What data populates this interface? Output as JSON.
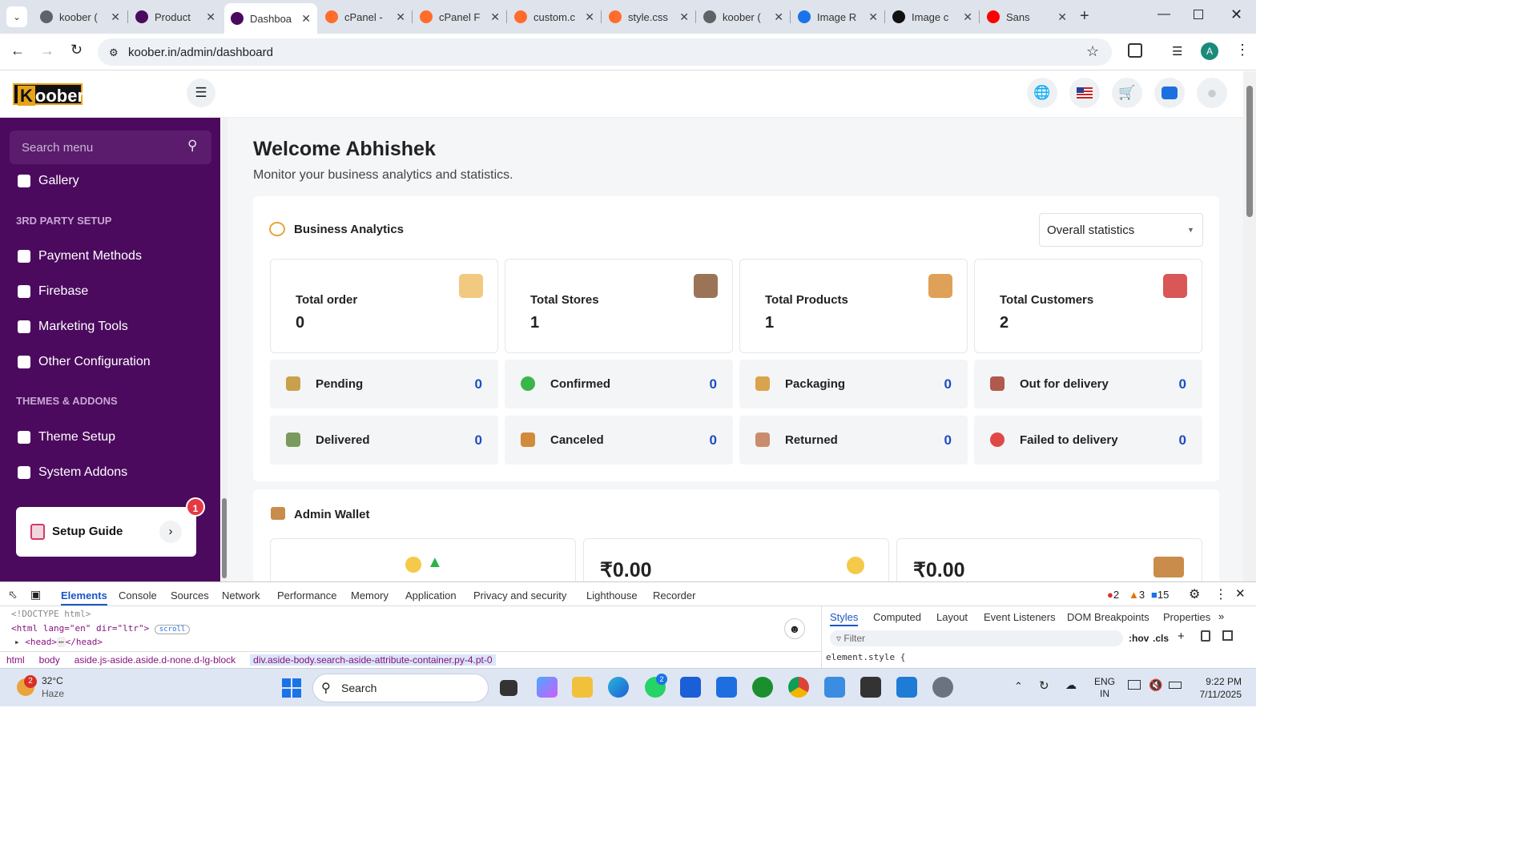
{
  "browser": {
    "tabs": [
      {
        "label": "koober (",
        "color": "#5f6368"
      },
      {
        "label": "Product",
        "color": "#4b0a5e"
      },
      {
        "label": "Dashboa",
        "color": "#4b0a5e"
      },
      {
        "label": "cPanel -",
        "color": "#ff6c2c"
      },
      {
        "label": "cPanel F",
        "color": "#ff6c2c"
      },
      {
        "label": "custom.c",
        "color": "#ff6c2c"
      },
      {
        "label": "style.css",
        "color": "#ff6c2c"
      },
      {
        "label": "koober (",
        "color": "#5f6368"
      },
      {
        "label": "Image R",
        "color": "#1a73e8"
      },
      {
        "label": "Image c",
        "color": "#111111"
      },
      {
        "label": "Sans",
        "color": "#ff0000"
      }
    ],
    "url": "koober.in/admin/dashboard",
    "profile_initial": "A"
  },
  "logo": {
    "k": "K",
    "rest": "oober"
  },
  "sidebar": {
    "search_placeholder": "Search menu",
    "gallery": "Gallery",
    "section_3rd": "3RD PARTY SETUP",
    "payment": "Payment Methods",
    "firebase": "Firebase",
    "marketing": "Marketing Tools",
    "other": "Other Configuration",
    "section_themes": "THEMES & ADDONS",
    "theme": "Theme Setup",
    "addons": "System Addons",
    "setup_guide": "Setup Guide",
    "setup_badge": "1"
  },
  "main": {
    "welcome": "Welcome Abhishek",
    "subtitle": "Monitor your business analytics and statistics.",
    "analytics_title": "Business Analytics",
    "dropdown": "Overall statistics",
    "stats": [
      {
        "label": "Total order",
        "value": "0",
        "icon": "order-icon"
      },
      {
        "label": "Total Stores",
        "value": "1",
        "icon": "store-icon"
      },
      {
        "label": "Total Products",
        "value": "1",
        "icon": "product-icon"
      },
      {
        "label": "Total Customers",
        "value": "2",
        "icon": "customer-icon"
      }
    ],
    "statuses": [
      {
        "label": "Pending",
        "value": "0",
        "color": "#c9a14b"
      },
      {
        "label": "Confirmed",
        "value": "0",
        "color": "#39b54a"
      },
      {
        "label": "Packaging",
        "value": "0",
        "color": "#d9a44b"
      },
      {
        "label": "Out for delivery",
        "value": "0",
        "color": "#b05a4b"
      },
      {
        "label": "Delivered",
        "value": "0",
        "color": "#7a9b5e"
      },
      {
        "label": "Canceled",
        "value": "0",
        "color": "#d18b3a"
      },
      {
        "label": "Returned",
        "value": "0",
        "color": "#c98c6c"
      },
      {
        "label": "Failed to delivery",
        "value": "0",
        "color": "#e04848"
      }
    ],
    "wallet_title": "Admin Wallet",
    "wallet_values": [
      "₹0.00",
      "₹0.00"
    ]
  },
  "devtools": {
    "tabs": [
      "Elements",
      "Console",
      "Sources",
      "Network",
      "Performance",
      "Memory",
      "Application",
      "Privacy and security",
      "Lighthouse",
      "Recorder"
    ],
    "errors": "2",
    "warnings": "3",
    "messages": "15",
    "code1": "<!DOCTYPE html>",
    "code2": "<html lang=\"en\" dir=\"ltr\">",
    "code2_badge": "scroll",
    "code3": "<head>",
    "code3b": "</head>",
    "crumbs": [
      "html",
      "body",
      "aside.js-aside.aside.d-none.d-lg-block",
      "div.aside-body.search-aside-attribute-container.py-4.pt-0"
    ],
    "style_tabs": [
      "Styles",
      "Computed",
      "Layout",
      "Event Listeners",
      "DOM Breakpoints",
      "Properties"
    ],
    "filter": "Filter",
    "hov": ":hov",
    "cls": ".cls",
    "element_style": "element.style {"
  },
  "taskbar": {
    "weather_temp": "32°C",
    "weather_desc": "Haze",
    "weather_badge": "2",
    "search": "Search",
    "lang1": "ENG",
    "lang2": "IN",
    "time": "9:22 PM",
    "date": "7/11/2025",
    "whatsapp_badge": "2"
  }
}
